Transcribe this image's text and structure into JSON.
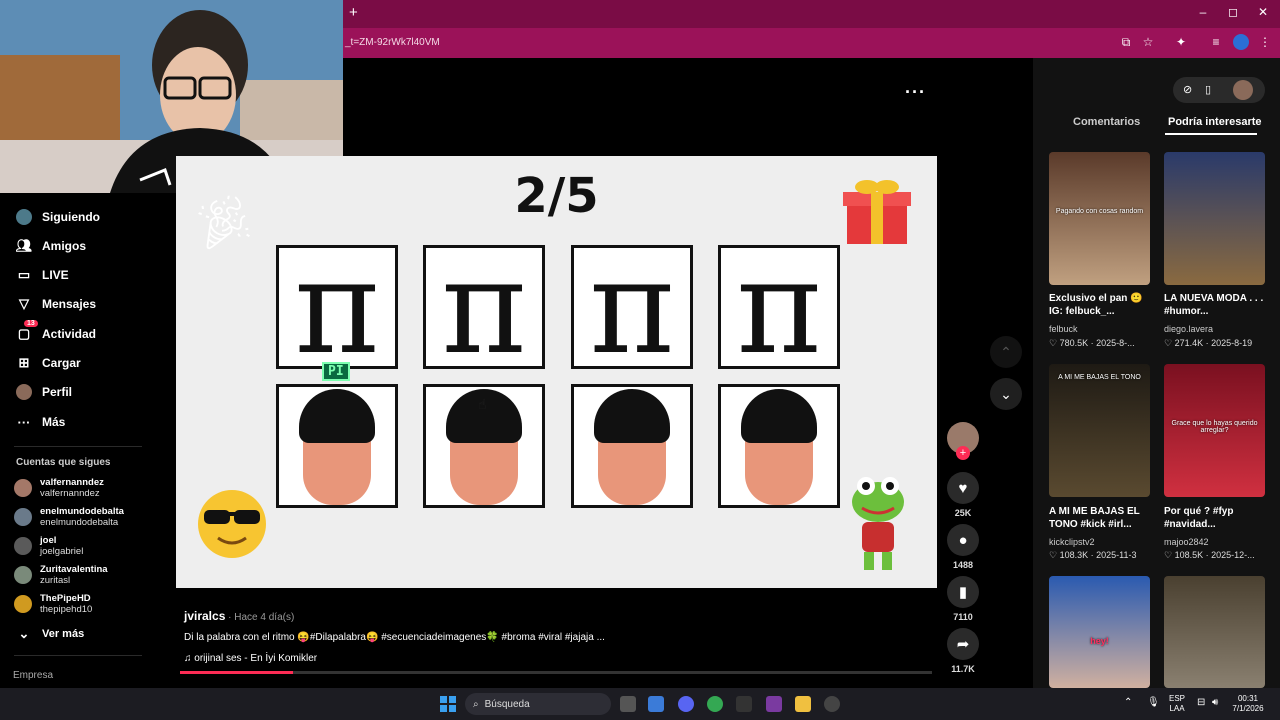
{
  "browser": {
    "new_tab": "+",
    "url": "_t=ZM-92rWk7l40VM",
    "window_controls": [
      "–",
      "◻",
      "✕"
    ]
  },
  "sidebar": {
    "nav": [
      {
        "label": "Siguiendo",
        "icon": "avatar-icon"
      },
      {
        "label": "Amigos",
        "icon": "friends-icon"
      },
      {
        "label": "LIVE",
        "icon": "live-icon"
      },
      {
        "label": "Mensajes",
        "icon": "messages-icon"
      },
      {
        "label": "Actividad",
        "icon": "activity-icon",
        "badge": "13"
      },
      {
        "label": "Cargar",
        "icon": "upload-icon"
      },
      {
        "label": "Perfil",
        "icon": "profile-icon"
      },
      {
        "label": "Más",
        "icon": "more-icon"
      }
    ],
    "following_header": "Cuentas que sigues",
    "accounts": [
      {
        "name": "valfernanndez",
        "handle": "valfernanndez"
      },
      {
        "name": "enelmundodebalta",
        "handle": "enelmundodebalta"
      },
      {
        "name": "joel",
        "handle": "joelgabriel"
      },
      {
        "name": "Zuritavalentina",
        "handle": "zuritasl"
      },
      {
        "name": "ThePipeHD",
        "handle": "thepipehd10"
      }
    ],
    "see_more": "Ver más",
    "footer": "Empresa"
  },
  "video": {
    "counter": "2/5",
    "pi_symbol": "π",
    "sticker_label": "PI",
    "progress": 0.15
  },
  "caption": {
    "user": "jviralcs",
    "time": " · Hace 4 día(s)",
    "description": "Di la palabra con el ritmo 😝#Dilapalabra😝 #secuenciadeimagenes🍀 #broma #viral #jajaja ...",
    "music": "orijinal ses - En İyi Komikler"
  },
  "actions": {
    "likes": "25K",
    "comments": "1488",
    "saves": "7110",
    "shares": "11.7K"
  },
  "right_panel": {
    "tabs": [
      "Comentarios",
      "Podría interesarte"
    ],
    "videos": [
      {
        "title": "Exclusivo el pan 🙂 IG: felbuck_...",
        "author": "felbuck",
        "stats": "♡ 780.5K · 2025-8-...",
        "thumb_text": "Pagando con cosas random"
      },
      {
        "title": "LA NUEVA MODA . . . #humor...",
        "author": "diego.lavera",
        "stats": "♡ 271.4K · 2025-8-19",
        "thumb_text": ""
      },
      {
        "title": "A MI ME BAJAS EL TONO #kick #irl...",
        "author": "kickclipstv2",
        "stats": "♡ 108.3K · 2025-11-3",
        "thumb_text": "A MI ME BAJAS EL TONO"
      },
      {
        "title": "Por qué ? #fyp #navidad...",
        "author": "majoo2842",
        "stats": "♡ 108.5K · 2025-12-...",
        "thumb_text": "Grace que lo hayas querido arreglar?"
      },
      {
        "title": "",
        "author": "",
        "stats": "",
        "thumb_text": "hey!"
      },
      {
        "title": "",
        "author": "",
        "stats": "",
        "thumb_text": ""
      }
    ]
  },
  "taskbar": {
    "search": "Búsqueda",
    "lang": "ESP\nLAA",
    "time": "00:31",
    "date": "7/1/2026"
  },
  "colors": {
    "accent": "#fe2c55",
    "tab_bar": "#7a0c45",
    "address_bar": "#9b1259"
  }
}
